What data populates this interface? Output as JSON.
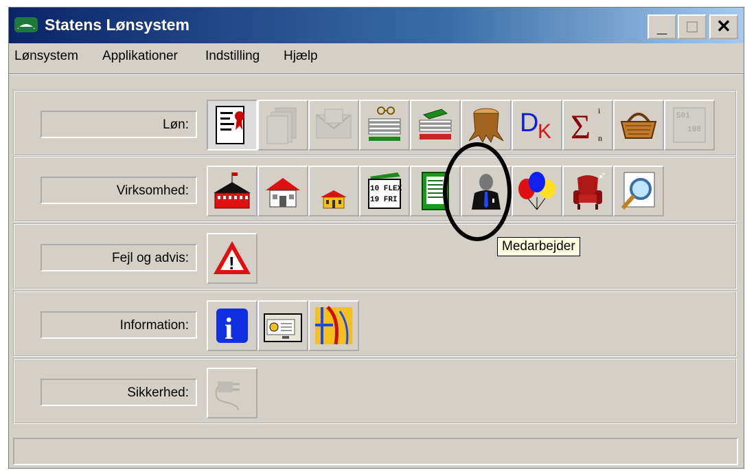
{
  "window": {
    "title": "Statens Lønsystem",
    "controls": [
      "_",
      "□",
      "✕"
    ]
  },
  "menu": [
    "Lønsystem",
    "Applikationer",
    "Indstilling",
    "Hjælp"
  ],
  "rows": [
    {
      "label": "Løn:",
      "buttons": [
        "document-ribbon-icon",
        "documents-icon",
        "envelope-icon",
        "papers-glasses-icon",
        "book-stack-icon",
        "tree-stump-icon",
        "dk-icon",
        "sigma-icon",
        "basket-icon",
        "table-grid-icon"
      ]
    },
    {
      "label": "Virksomhed:",
      "buttons": [
        "large-building-icon",
        "house-icon",
        "small-house-icon",
        "flex-calendar-icon",
        "ledger-icon",
        "employee-icon",
        "balloons-icon",
        "armchair-icon",
        "search-icon"
      ]
    },
    {
      "label": "Fejl og advis:",
      "buttons": [
        "warning-icon"
      ]
    },
    {
      "label": "Information:",
      "buttons": [
        "info-icon",
        "card-reader-icon",
        "map-icon"
      ]
    },
    {
      "label": "Sikkerhed:",
      "buttons": [
        "plug-icon"
      ]
    }
  ],
  "icon_text": {
    "dk": "DK",
    "sigma": "Σ",
    "flex1": "10 FLEX",
    "flex2": "19 FRI",
    "info": "i",
    "warning": "!",
    "num1": "501",
    "num2": "198"
  },
  "tooltip": "Medarbejder",
  "status": ""
}
